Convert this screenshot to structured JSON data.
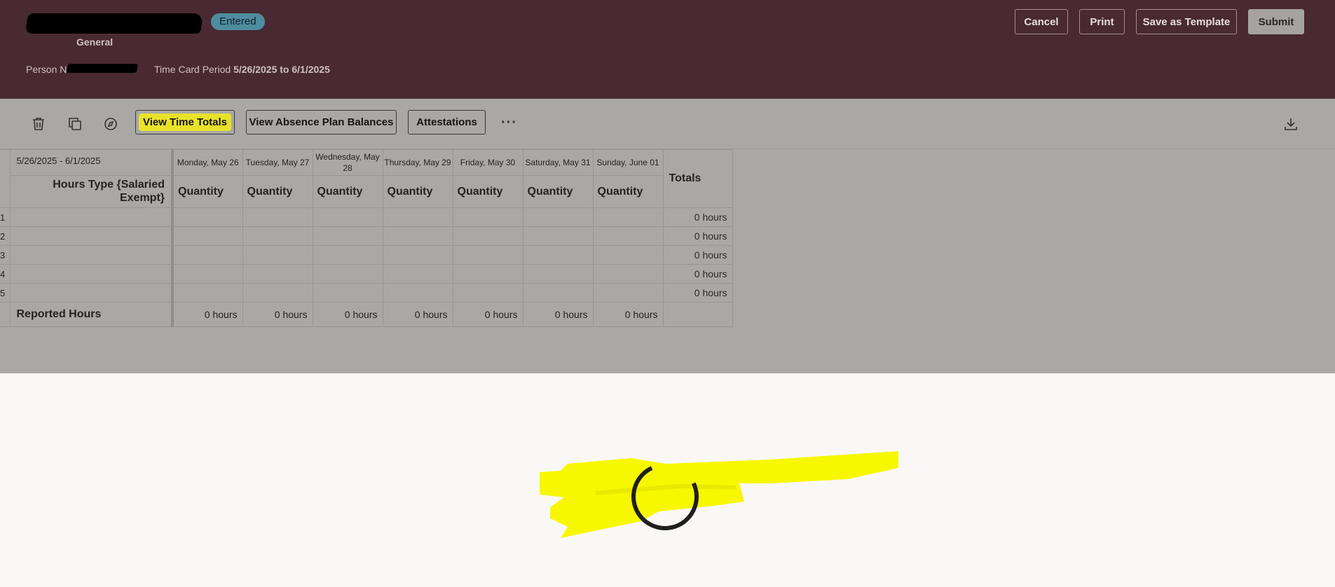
{
  "header": {
    "status_badge": "Entered",
    "subtitle": "General",
    "person_label": "Person Nu",
    "period_label": "Time Card Period",
    "period_value": "5/26/2025 to 6/1/2025",
    "buttons": {
      "cancel": "Cancel",
      "print": "Print",
      "save_template": "Save as Template",
      "submit": "Submit"
    },
    "colors": {
      "background": "#4a2a32",
      "badge": "#4e8ca0"
    }
  },
  "toolbar": {
    "icons": [
      "delete-icon",
      "copy-icon",
      "compass-icon",
      "more-icon",
      "download-icon"
    ],
    "more_glyph": "···",
    "view_time_totals": "View Time Totals",
    "view_absence": "View Absence Plan Balances",
    "attestations": "Attestations",
    "highlight_color": "#e8e22a"
  },
  "table": {
    "period": "5/26/2025 - 6/1/2025",
    "hours_type": "Hours Type {Salaried Exempt}",
    "days": [
      {
        "label": "Monday, May 26",
        "qty": "Quantity"
      },
      {
        "label": "Tuesday, May 27",
        "qty": "Quantity"
      },
      {
        "label": "Wednesday, May 28",
        "qty": "Quantity"
      },
      {
        "label": "Thursday, May 29",
        "qty": "Quantity"
      },
      {
        "label": "Friday, May 30",
        "qty": "Quantity"
      },
      {
        "label": "Saturday, May 31",
        "qty": "Quantity"
      },
      {
        "label": "Sunday, June 01",
        "qty": "Quantity"
      }
    ],
    "totals_header": "Totals",
    "rows": [
      {
        "num": "1",
        "total": "0 hours"
      },
      {
        "num": "2",
        "total": "0 hours"
      },
      {
        "num": "3",
        "total": "0 hours"
      },
      {
        "num": "4",
        "total": "0 hours"
      },
      {
        "num": "5",
        "total": "0 hours"
      }
    ],
    "reported_label": "Reported Hours",
    "reported_values": [
      "0 hours",
      "0 hours",
      "0 hours",
      "0 hours",
      "0 hours",
      "0 hours",
      "0 hours"
    ]
  },
  "loading": {
    "spinner_icon": "loading-spinner-icon",
    "scribble_color": "#f7f700"
  }
}
